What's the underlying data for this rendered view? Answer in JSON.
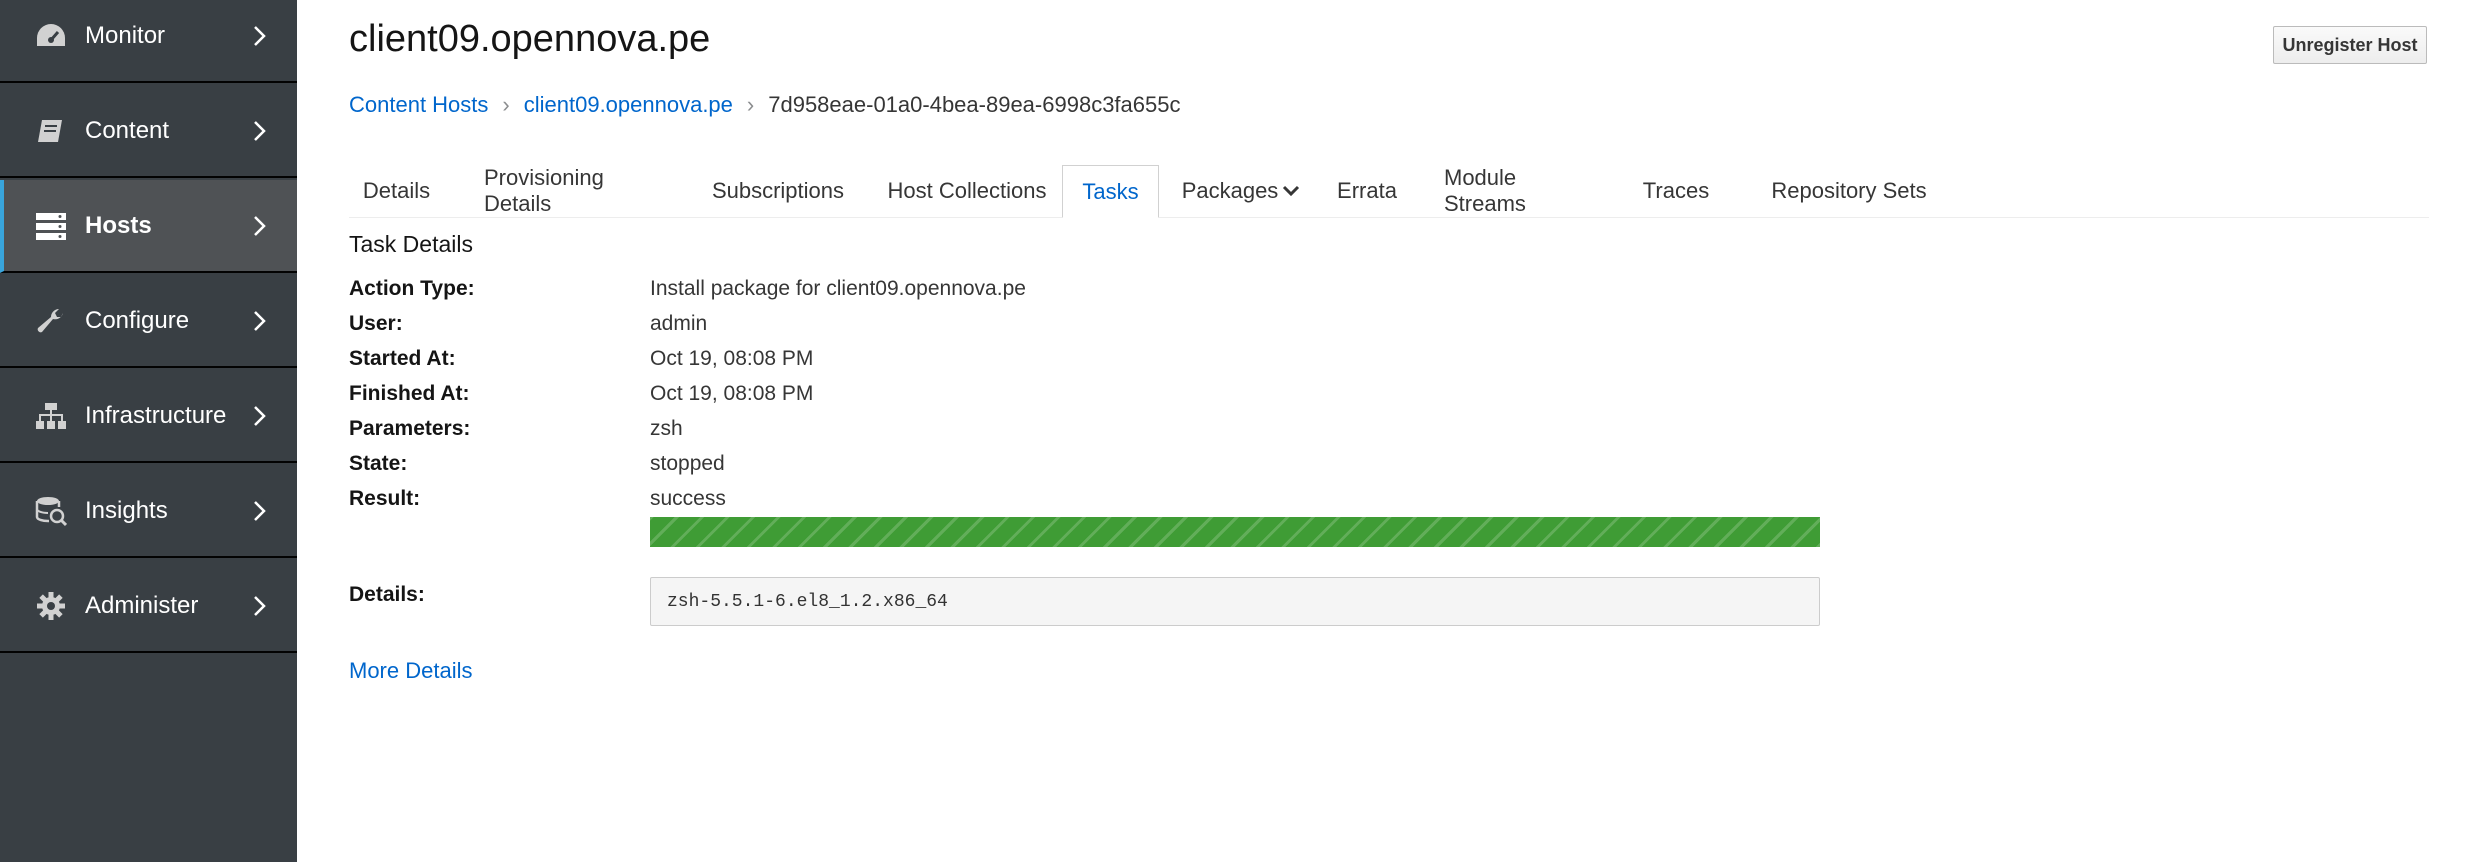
{
  "sidebar": {
    "items": [
      {
        "label": "Monitor",
        "icon": "dashboard-icon"
      },
      {
        "label": "Content",
        "icon": "book-icon"
      },
      {
        "label": "Hosts",
        "icon": "server-icon",
        "active": true
      },
      {
        "label": "Configure",
        "icon": "wrench-icon"
      },
      {
        "label": "Infrastructure",
        "icon": "network-icon"
      },
      {
        "label": "Insights",
        "icon": "insights-icon"
      },
      {
        "label": "Administer",
        "icon": "gear-icon"
      }
    ]
  },
  "header": {
    "title": "client09.opennova.pe",
    "unregister_label": "Unregister Host"
  },
  "breadcrumb": {
    "items": [
      "Content Hosts",
      "client09.opennova.pe"
    ],
    "current": "7d958eae-01a0-4bea-89ea-6998c3fa655c"
  },
  "tabs": [
    {
      "label": "Details"
    },
    {
      "label": "Provisioning Details"
    },
    {
      "label": "Subscriptions"
    },
    {
      "label": "Host Collections"
    },
    {
      "label": "Tasks",
      "active": true
    },
    {
      "label": "Packages",
      "dropdown": true
    },
    {
      "label": "Errata"
    },
    {
      "label": "Module Streams"
    },
    {
      "label": "Traces"
    },
    {
      "label": "Repository Sets"
    }
  ],
  "task": {
    "section_title": "Task Details",
    "fields": [
      {
        "label": "Action Type:",
        "value": "Install package for client09.opennova.pe"
      },
      {
        "label": "User:",
        "value": "admin"
      },
      {
        "label": "Started At:",
        "value": "Oct 19, 08:08 PM"
      },
      {
        "label": "Finished At:",
        "value": "Oct 19, 08:08 PM"
      },
      {
        "label": "Parameters:",
        "value": "zsh"
      },
      {
        "label": "State:",
        "value": "stopped"
      },
      {
        "label": "Result:",
        "value": "success"
      }
    ],
    "progress_percent": 100,
    "progress_color": "#3f9c35",
    "details_label": "Details:",
    "details_value": "zsh-5.5.1-6.el8_1.2.x86_64",
    "more_details_label": "More Details"
  },
  "colors": {
    "sidebar_bg": "#393f44",
    "link": "#0066cc",
    "active_accent": "#39a5dc"
  }
}
